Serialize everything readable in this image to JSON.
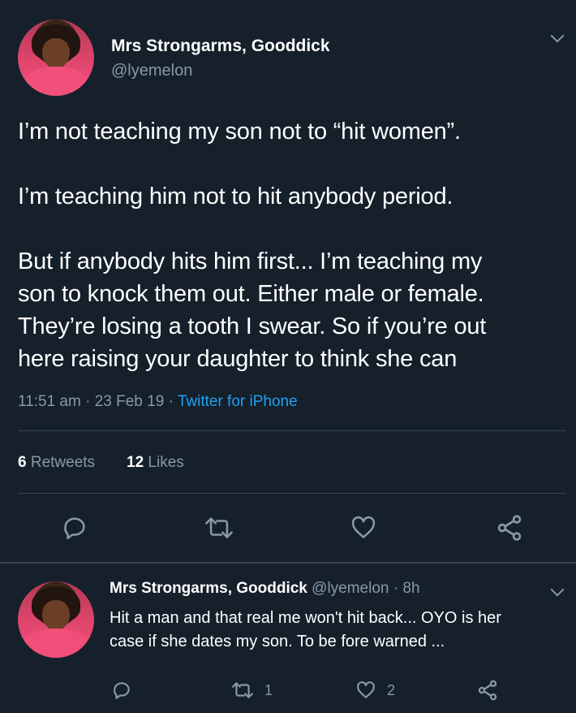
{
  "main_tweet": {
    "author_name": "Mrs Strongarms, Gooddick",
    "handle": "@lyemelon",
    "text_lines": [
      "I’m not teaching my son not to “hit women”.",
      "",
      "I’m teaching him not to hit anybody period.",
      "",
      "But if anybody hits him first... I’m teaching my",
      "son to knock them out. Either male or female.",
      "They’re losing a tooth I swear. So if you’re out",
      "here raising your daughter to think she can"
    ],
    "time": "11:51 am",
    "date": "23 Feb 19",
    "separator": "·",
    "source": "Twitter for iPhone",
    "retweets_count": "6",
    "retweets_label": "Retweets",
    "likes_count": "12",
    "likes_label": "Likes"
  },
  "reply": {
    "author_name": "Mrs Strongarms, Gooddick",
    "handle": "@lyemelon",
    "separator": "·",
    "time_ago": "8h",
    "text_line1": "Hit a man and that real me won't hit back... OYO is her",
    "text_line2": "case if she dates my son. To be fore warned ...",
    "retweet_count": "1",
    "like_count": "2"
  },
  "icons": {
    "reply": "reply-icon",
    "retweet": "retweet-icon",
    "like": "heart-icon",
    "share": "share-icon",
    "menu": "chevron-down-icon"
  },
  "colors": {
    "background": "#15202b",
    "text": "#ffffff",
    "muted": "#8899a6",
    "link": "#1da1f2",
    "divider": "#38444d"
  }
}
